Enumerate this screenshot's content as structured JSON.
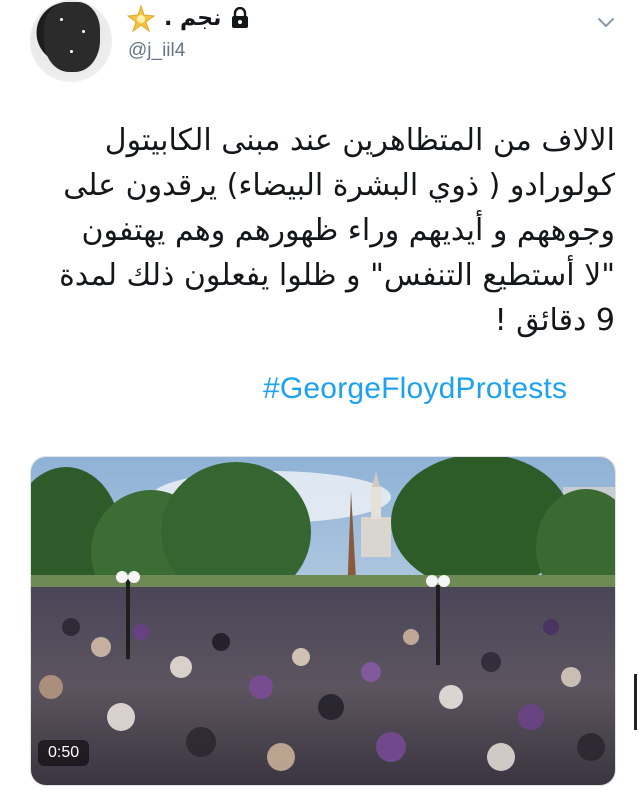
{
  "tweet": {
    "display_name": "نجم .",
    "handle": "@j_iil4",
    "text_lines": [
      "الالاف من المتظاهرين عند مبنى الكابيتول",
      "كولورادو ( ذوي البشرة البيضاء) يرقدون على",
      "وجوههم و أيديهم وراء ظهورهم وهم يهتفون",
      "\"لا أستطيع التنفس\" و ظلوا يفعلون ذلك لمدة",
      "9 دقائق !"
    ],
    "hashtag": "#GeorgeFloydProtests",
    "video": {
      "duration": "0:50"
    }
  },
  "icons": {
    "star": "sparkle-star-icon",
    "lock": "lock-icon",
    "menu": "chevron-down-icon"
  },
  "colors": {
    "hashtag": "#1da1f2",
    "handle": "#657786",
    "text": "#14171a"
  }
}
